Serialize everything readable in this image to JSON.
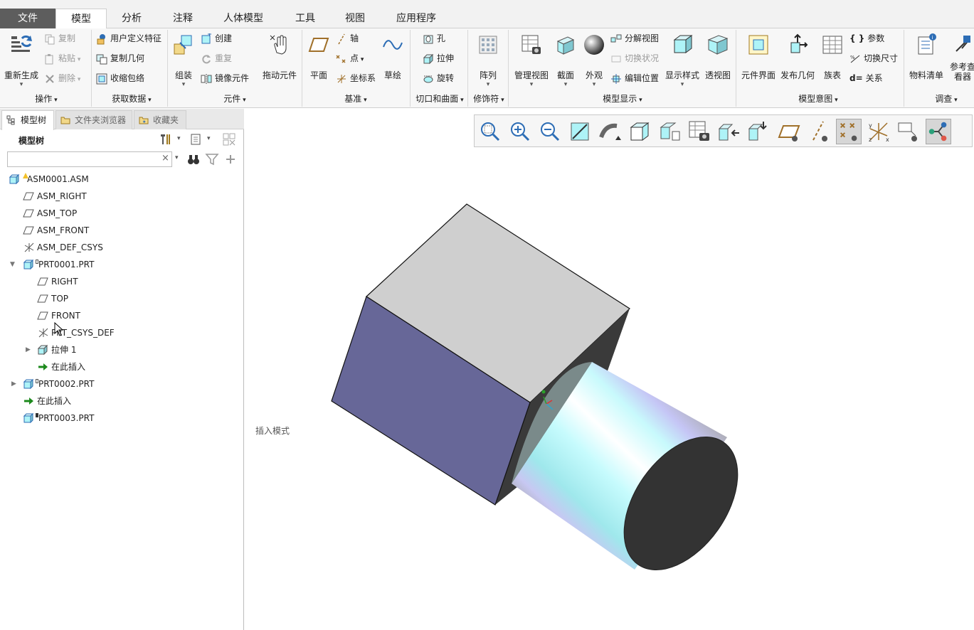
{
  "tabs": [
    {
      "label": "文件"
    },
    {
      "label": "模型"
    },
    {
      "label": "分析"
    },
    {
      "label": "注释"
    },
    {
      "label": "人体模型"
    },
    {
      "label": "工具"
    },
    {
      "label": "视图"
    },
    {
      "label": "应用程序"
    }
  ],
  "ribbon": {
    "groups": {
      "operations": "操作",
      "get_data": "获取数据",
      "component": "元件",
      "datum": "基准",
      "cut_surface": "切口和曲面",
      "modifiers": "修饰符",
      "model_display": "模型显示",
      "model_intent": "模型意图",
      "investigate": "调查"
    },
    "regenerate": "重新生成",
    "copy": "复制",
    "paste": "粘贴",
    "delete": "删除",
    "user_defined_feature": "用户定义特征",
    "copy_geometry": "复制几何",
    "shrinkwrap": "收缩包络",
    "assemble": "组装",
    "create": "创建",
    "repeat": "重复",
    "mirror_component": "镜像元件",
    "drag_components": "拖动元件",
    "plane": "平面",
    "axis": "轴",
    "point": "点",
    "csys": "坐标系",
    "sketch": "草绘",
    "hole": "孔",
    "extrude": "拉伸",
    "revolve": "旋转",
    "pattern": "阵列",
    "manage_views": "管理视图",
    "section": "截面",
    "appearance": "外观",
    "explode_view": "分解视图",
    "toggle_status": "切换状况",
    "edit_position": "编辑位置",
    "display_style": "显示样式",
    "perspective": "透视图",
    "component_interface": "元件界面",
    "publish_geometry": "发布几何",
    "family_table": "族表",
    "parameters": "参数",
    "switch_dimensions": "切换尺寸",
    "relations": "关系",
    "bill_of_materials": "物料清单",
    "reference_viewer": "参考查看器"
  },
  "panel": {
    "tabs": [
      "模型树",
      "文件夹浏览器",
      "收藏夹"
    ],
    "tree_title": "模型树",
    "search_value": "",
    "clear_glyph": "×"
  },
  "tree": [
    {
      "label": "ASM0001.ASM",
      "icon": "assembly-icon"
    },
    {
      "label": "ASM_RIGHT",
      "icon": "datum-plane-icon"
    },
    {
      "label": "ASM_TOP",
      "icon": "datum-plane-icon"
    },
    {
      "label": "ASM_FRONT",
      "icon": "datum-plane-icon"
    },
    {
      "label": "ASM_DEF_CSYS",
      "icon": "csys-icon"
    },
    {
      "label": "PRT0001.PRT",
      "icon": "part-icon"
    },
    {
      "label": "RIGHT",
      "icon": "datum-plane-icon"
    },
    {
      "label": "TOP",
      "icon": "datum-plane-icon"
    },
    {
      "label": "FRONT",
      "icon": "datum-plane-icon"
    },
    {
      "label": "PRT_CSYS_DEF",
      "icon": "csys-icon"
    },
    {
      "label": "拉伸 1",
      "icon": "extrude-icon"
    },
    {
      "label": "在此插入",
      "icon": "insert-arrow-icon"
    },
    {
      "label": "PRT0002.PRT",
      "icon": "part-icon"
    },
    {
      "label": "在此插入",
      "icon": "insert-arrow-icon"
    },
    {
      "label": "PRT0003.PRT",
      "icon": "part-icon"
    }
  ],
  "graphics": {
    "insert_mode": "插入模式"
  },
  "colors": {
    "accent": "#2d6db5",
    "box_top": "#cfcfcf",
    "box_front": "#676798",
    "box_dark": "#3a3a3a",
    "cylinder_cyan": "#aef3f7"
  }
}
